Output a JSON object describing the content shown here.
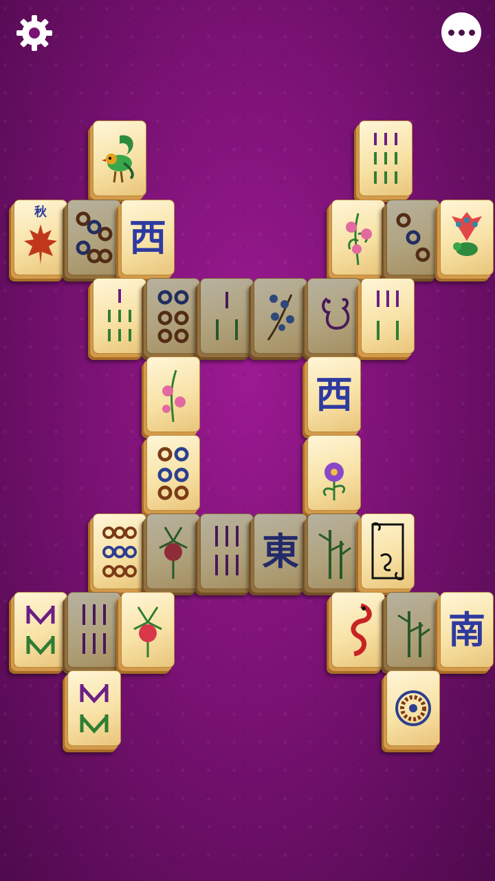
{
  "toolbar": {
    "settings_icon": "gear-icon",
    "menu_icon": "more-dots-icon"
  },
  "colors": {
    "felt": "#7a1274",
    "tile_face": "#f8e2a6",
    "tile_edge": "#a86c28",
    "bamboo_green": "#2f7d32",
    "bamboo_purple": "#6b1f86",
    "circle_blue": "#2c3f8f",
    "circle_brown": "#7a3b16",
    "wind_blue": "#2e3aa0"
  },
  "tiles": {
    "west_1": "西",
    "west_2": "西",
    "east": "東",
    "south": "南",
    "autumn": "秋"
  }
}
